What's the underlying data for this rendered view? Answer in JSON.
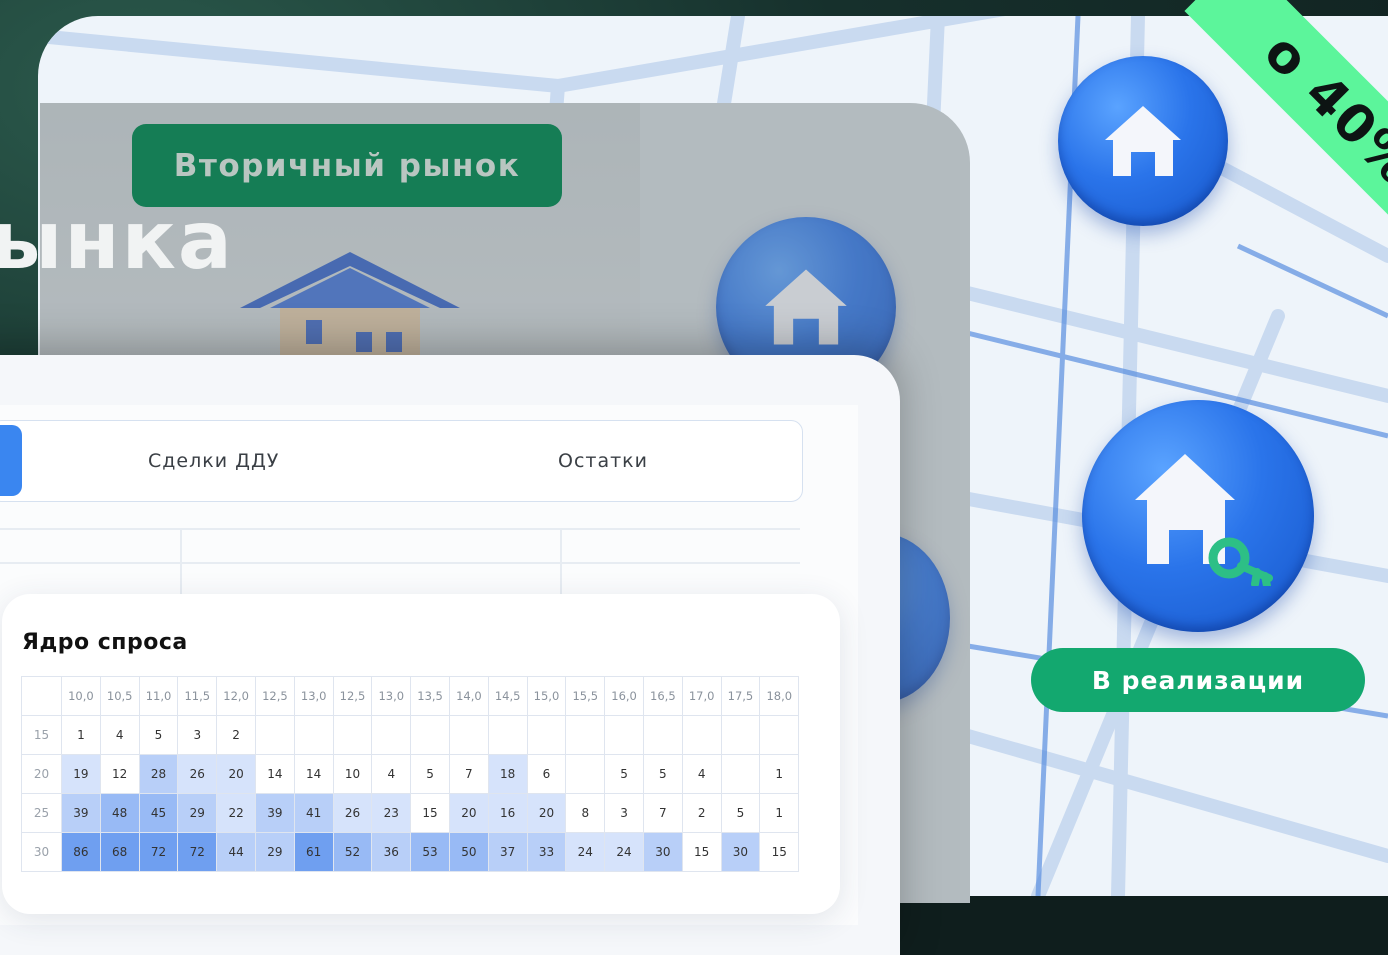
{
  "ribbon": {
    "text": "о 40%"
  },
  "status": {
    "label": "В реализации"
  },
  "secondary_market": {
    "label": "Вторичный рынок"
  },
  "headline": {
    "text": "ынка"
  },
  "tabs": [
    {
      "label": ""
    },
    {
      "label": "Сделки ДДУ"
    },
    {
      "label": "Остатки"
    }
  ],
  "demand_table": {
    "title": "Ядро спроса",
    "columns": [
      "10,0",
      "10,5",
      "11,0",
      "11,5",
      "12,0",
      "12,5",
      "13,0",
      "12,5",
      "13,0",
      "13,5",
      "14,0",
      "14,5",
      "15,0",
      "15,5",
      "16,0",
      "16,5",
      "17,0",
      "17,5",
      "18,0"
    ],
    "rows": [
      {
        "label": "15",
        "cells": [
          "1",
          "4",
          "5",
          "3",
          "2",
          "",
          "",
          "",
          "",
          "",
          "",
          "",
          "",
          "",
          "",
          "",
          "",
          "",
          ""
        ]
      },
      {
        "label": "20",
        "cells": [
          "19",
          "12",
          "28",
          "26",
          "20",
          "14",
          "14",
          "10",
          "4",
          "5",
          "7",
          "18",
          "6",
          "",
          "5",
          "5",
          "4",
          "",
          "1"
        ]
      },
      {
        "label": "25",
        "cells": [
          "39",
          "48",
          "45",
          "29",
          "22",
          "39",
          "41",
          "26",
          "23",
          "15",
          "20",
          "16",
          "20",
          "8",
          "3",
          "7",
          "2",
          "5",
          "1"
        ]
      },
      {
        "label": "30",
        "cells": [
          "86",
          "68",
          "72",
          "72",
          "44",
          "29",
          "61",
          "52",
          "36",
          "53",
          "50",
          "37",
          "33",
          "24",
          "24",
          "30",
          "15",
          "30",
          "15"
        ]
      }
    ]
  },
  "colors": {
    "accent_blue": "#3a86f0",
    "accent_green": "#13a86f",
    "ribbon_green": "#5cf59b"
  }
}
